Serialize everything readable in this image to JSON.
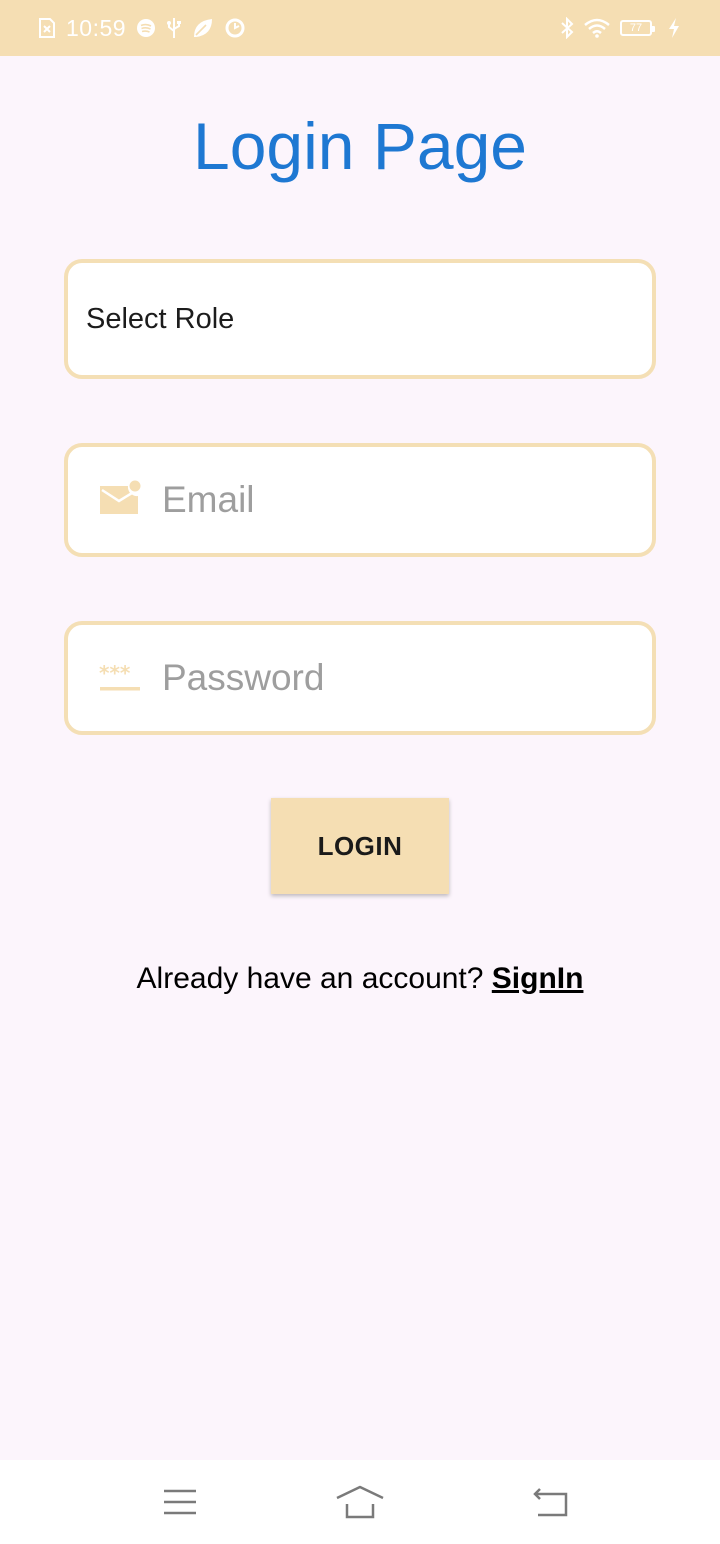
{
  "status_bar": {
    "time": "10:59",
    "battery_level": "77",
    "left_icons": [
      "sim-alert-icon",
      "spotify-icon",
      "usb-icon",
      "leaf-icon",
      "sync-icon"
    ],
    "right_icons": [
      "bluetooth-icon",
      "wifi-icon",
      "battery-icon",
      "charging-icon"
    ]
  },
  "page": {
    "title": "Login Page"
  },
  "form": {
    "role_select": {
      "value": "Select Role"
    },
    "email": {
      "placeholder": "Email",
      "icon": "mail-icon"
    },
    "password": {
      "placeholder": "Password",
      "icon": "password-icon"
    },
    "login_label": "LOGIN",
    "account_prompt": "Already have an account? ",
    "signin_label": "SignIn"
  },
  "nav": {
    "items": [
      "menu-icon",
      "home-icon",
      "back-icon"
    ]
  },
  "colors": {
    "accent": "#f5deb3",
    "title": "#1e78d2",
    "background": "#fcf5fc"
  }
}
